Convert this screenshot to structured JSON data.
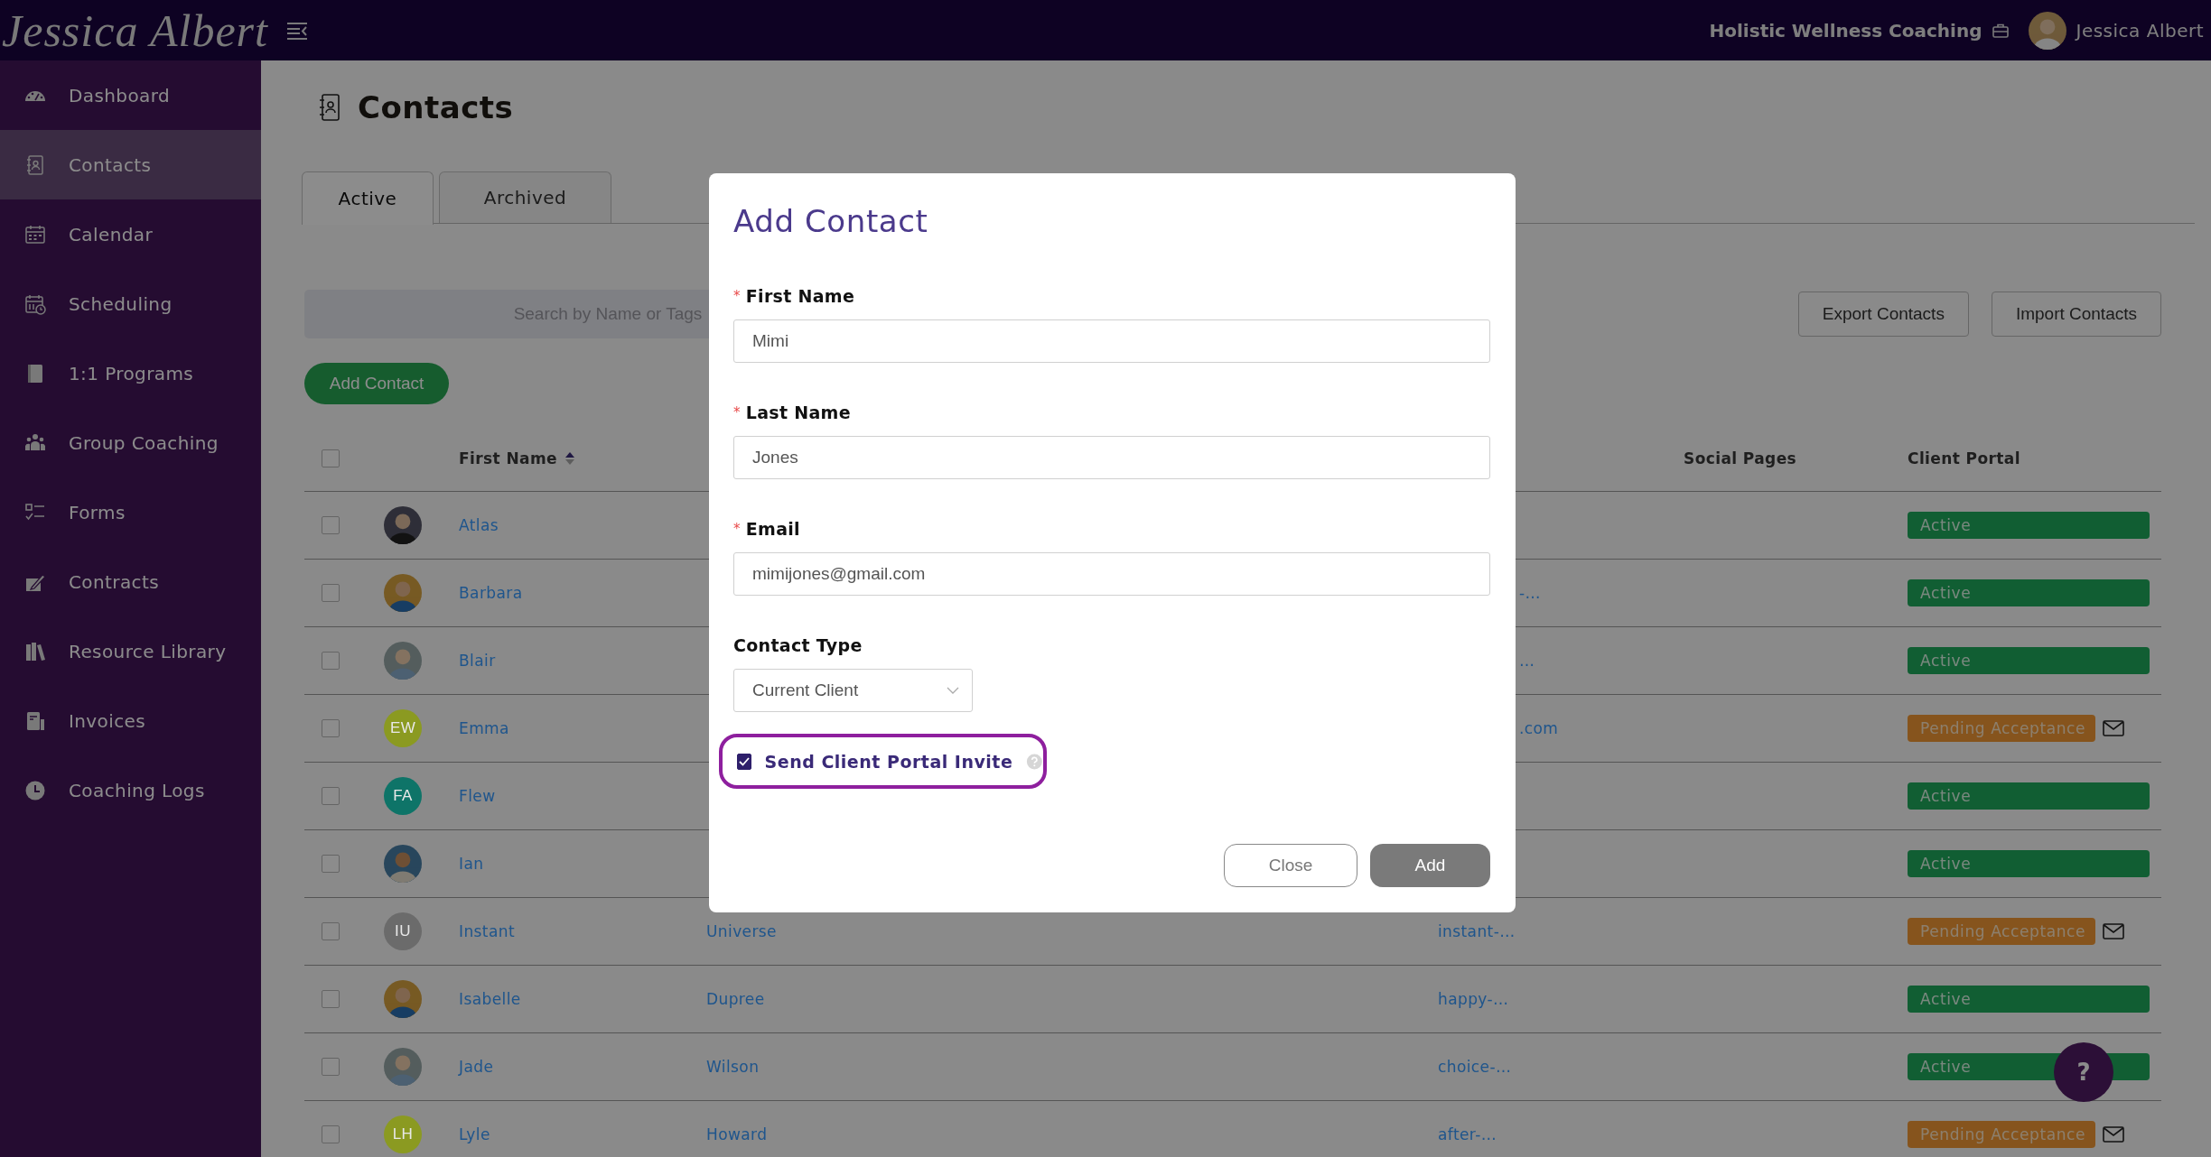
{
  "topbar": {
    "logo": "Jessica Albert",
    "business": "Holistic Wellness Coaching",
    "user": "Jessica Albert"
  },
  "sidebar": {
    "items": [
      {
        "label": "Dashboard",
        "selected": false
      },
      {
        "label": "Contacts",
        "selected": true
      },
      {
        "label": "Calendar",
        "selected": false
      },
      {
        "label": "Scheduling",
        "selected": false
      },
      {
        "label": "1:1 Programs",
        "selected": false
      },
      {
        "label": "Group Coaching",
        "selected": false
      },
      {
        "label": "Forms",
        "selected": false
      },
      {
        "label": "Contracts",
        "selected": false
      },
      {
        "label": "Resource Library",
        "selected": false
      },
      {
        "label": "Invoices",
        "selected": false
      },
      {
        "label": "Coaching Logs",
        "selected": false
      }
    ]
  },
  "page": {
    "title": "Contacts",
    "tabs": [
      {
        "label": "Active",
        "selected": true
      },
      {
        "label": "Archived",
        "selected": false
      }
    ],
    "search": {
      "placeholder": "Search by Name or Tags"
    },
    "buttons": [
      "Export Contacts",
      "Import Contacts"
    ],
    "add_button": "Add Contact"
  },
  "table": {
    "all_selected": false,
    "columns": [
      {
        "kind": "first_name",
        "label": "First Name",
        "sorted": true
      },
      {
        "kind": "social",
        "label": "Social Pages"
      },
      {
        "kind": "portal",
        "label": "Client Portal"
      }
    ],
    "rows": [
      {
        "selected": false,
        "first_name": "Atlas",
        "portal": {
          "kind": "active",
          "label": "Active"
        }
      },
      {
        "selected": false,
        "first_name": "Barbara",
        "email": "-…",
        "email_partly_hidden": true,
        "portal": {
          "kind": "active",
          "label": "Active"
        }
      },
      {
        "selected": false,
        "first_name": "Blair",
        "email": "…",
        "email_partly_hidden": true,
        "portal": {
          "kind": "active",
          "label": "Active"
        }
      },
      {
        "selected": false,
        "avatar": {
          "kind": "initials",
          "initials": "EW",
          "color": "#8b9a21"
        },
        "first_name": "Emma",
        "email": ".com",
        "email_partly_hidden": true,
        "portal": {
          "kind": "pending",
          "label": "Pending Acceptance"
        },
        "envelope": true
      },
      {
        "selected": false,
        "avatar": {
          "kind": "initials",
          "initials": "FA",
          "color": "#0e7468"
        },
        "first_name": "Flew",
        "portal": {
          "kind": "active",
          "label": "Active"
        }
      },
      {
        "selected": false,
        "first_name": "Ian",
        "portal": {
          "kind": "active",
          "label": "Active"
        }
      },
      {
        "selected": false,
        "avatar": {
          "kind": "initials",
          "initials": "IU",
          "color": "#6b6b6b"
        },
        "first_name": "Instant",
        "last_name": "Universe",
        "email": "instant-…",
        "portal": {
          "kind": "pending",
          "label": "Pending Acceptance"
        },
        "envelope": true
      },
      {
        "selected": false,
        "first_name": "Isabelle",
        "last_name": "Dupree",
        "email": "happy-…",
        "portal": {
          "kind": "active",
          "label": "Active"
        }
      },
      {
        "selected": false,
        "first_name": "Jade",
        "last_name": "Wilson",
        "email": "choice-…",
        "portal": {
          "kind": "active",
          "label": "Active"
        }
      },
      {
        "selected": false,
        "avatar": {
          "kind": "initials",
          "initials": "LH",
          "color": "#8b9a21"
        },
        "first_name": "Lyle",
        "last_name": "Howard",
        "email": "after-…",
        "portal": {
          "kind": "pending",
          "label": "Pending Acceptance"
        },
        "envelope": true
      }
    ]
  },
  "modal": {
    "title": "Add Contact",
    "fields": [
      {
        "label": "First Name",
        "required_mark": "*",
        "value": "Mimi"
      },
      {
        "label": "Last Name",
        "required_mark": "*",
        "value": "Jones"
      },
      {
        "label": "Email",
        "required_mark": "*",
        "value": "mimijones@gmail.com"
      }
    ],
    "contact_type": {
      "label": "Contact Type",
      "value": "Current Client"
    },
    "invite": {
      "label": "Send Client Portal Invite",
      "checked": true,
      "highlighted": true
    },
    "buttons": [
      {
        "label": "Close",
        "kind": "secondary"
      },
      {
        "label": "Add",
        "kind": "primary"
      }
    ]
  },
  "help": {
    "label": "?"
  }
}
